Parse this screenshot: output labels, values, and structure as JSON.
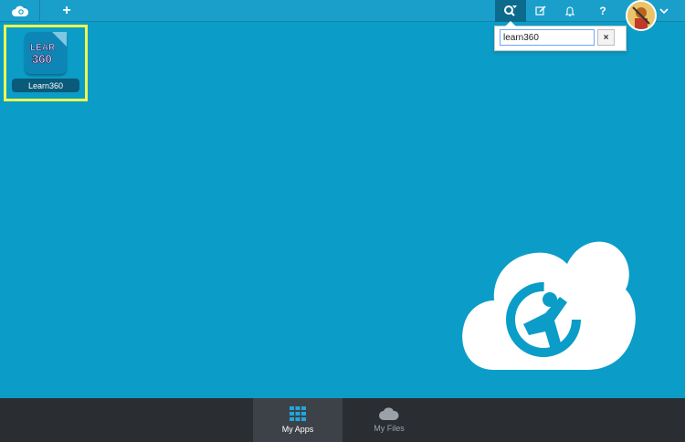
{
  "topbar": {
    "add_label": "+",
    "help_label": "?",
    "colors": {
      "bar": "#1a9fcb",
      "active_tool": "#0c6a8c"
    }
  },
  "search": {
    "value": "learn360",
    "clear_label": "×"
  },
  "apps": [
    {
      "label": "Learn360",
      "icon_text_top": "LEAR",
      "icon_text_bottom": "360",
      "highlight_color": "#eef84e"
    }
  ],
  "bottom_nav": {
    "tabs": [
      {
        "label": "My Apps",
        "icon": "grid-icon",
        "active": true
      },
      {
        "label": "My Files",
        "icon": "cloud-icon",
        "active": false
      }
    ]
  },
  "icons": {
    "logo": "cloud-logo-icon",
    "search": "search-filter-icon",
    "edit": "edit-icon",
    "bell": "bell-icon",
    "help": "help-icon",
    "avatar": "avatar",
    "menu": "chevron-down-icon"
  }
}
